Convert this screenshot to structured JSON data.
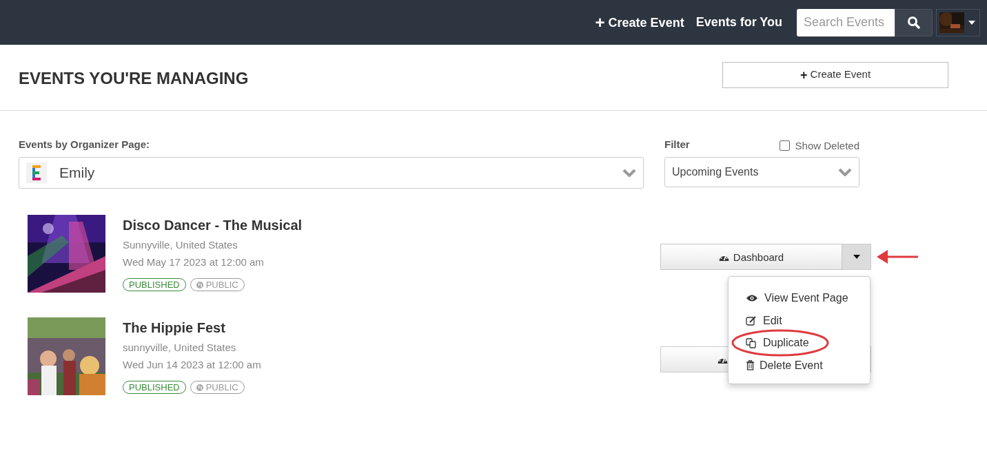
{
  "navbar": {
    "create_event": {
      "icon": "+",
      "label": "Create Event"
    },
    "events_for_you": "Events for You",
    "search": {
      "placeholder": "Search Events"
    }
  },
  "page_title": "EVENTS YOU'RE MANAGING",
  "create_event_button": {
    "icon": "+",
    "label": "Create Event"
  },
  "organizer": {
    "label": "Events by Organizer Page:",
    "value": "Emily"
  },
  "filter": {
    "label": "Filter",
    "value": "Upcoming Events",
    "show_deleted": {
      "label": "Show Deleted",
      "checked": false
    }
  },
  "events": [
    {
      "title": "Disco Dancer - The Musical",
      "location": "Sunnyville, United States",
      "date": "Wed May 17 2023 at 12:00 am",
      "badges": [
        {
          "label": "PUBLISHED",
          "color": "#3a8a3a",
          "globe": false
        },
        {
          "label": "PUBLIC",
          "color": "#999999",
          "globe": true
        }
      ],
      "dashboard": {
        "label": "Dashboard"
      },
      "menu_open": true
    },
    {
      "title": "The Hippie Fest",
      "location": "sunnyville, United States",
      "date": "Wed Jun 14 2023 at 12:00 am",
      "badges": [
        {
          "label": "PUBLISHED",
          "color": "#3a8a3a",
          "globe": false
        },
        {
          "label": "PUBLIC",
          "color": "#999999",
          "globe": true
        }
      ],
      "menu_open": false
    }
  ],
  "menu": [
    {
      "kind": "view",
      "label": "View Event Page",
      "circled": false
    },
    {
      "kind": "edit",
      "label": "Edit",
      "circled": false
    },
    {
      "kind": "duplicate",
      "label": "Duplicate",
      "circled": true
    },
    {
      "kind": "delete",
      "label": "Delete Event",
      "circled": false
    }
  ]
}
